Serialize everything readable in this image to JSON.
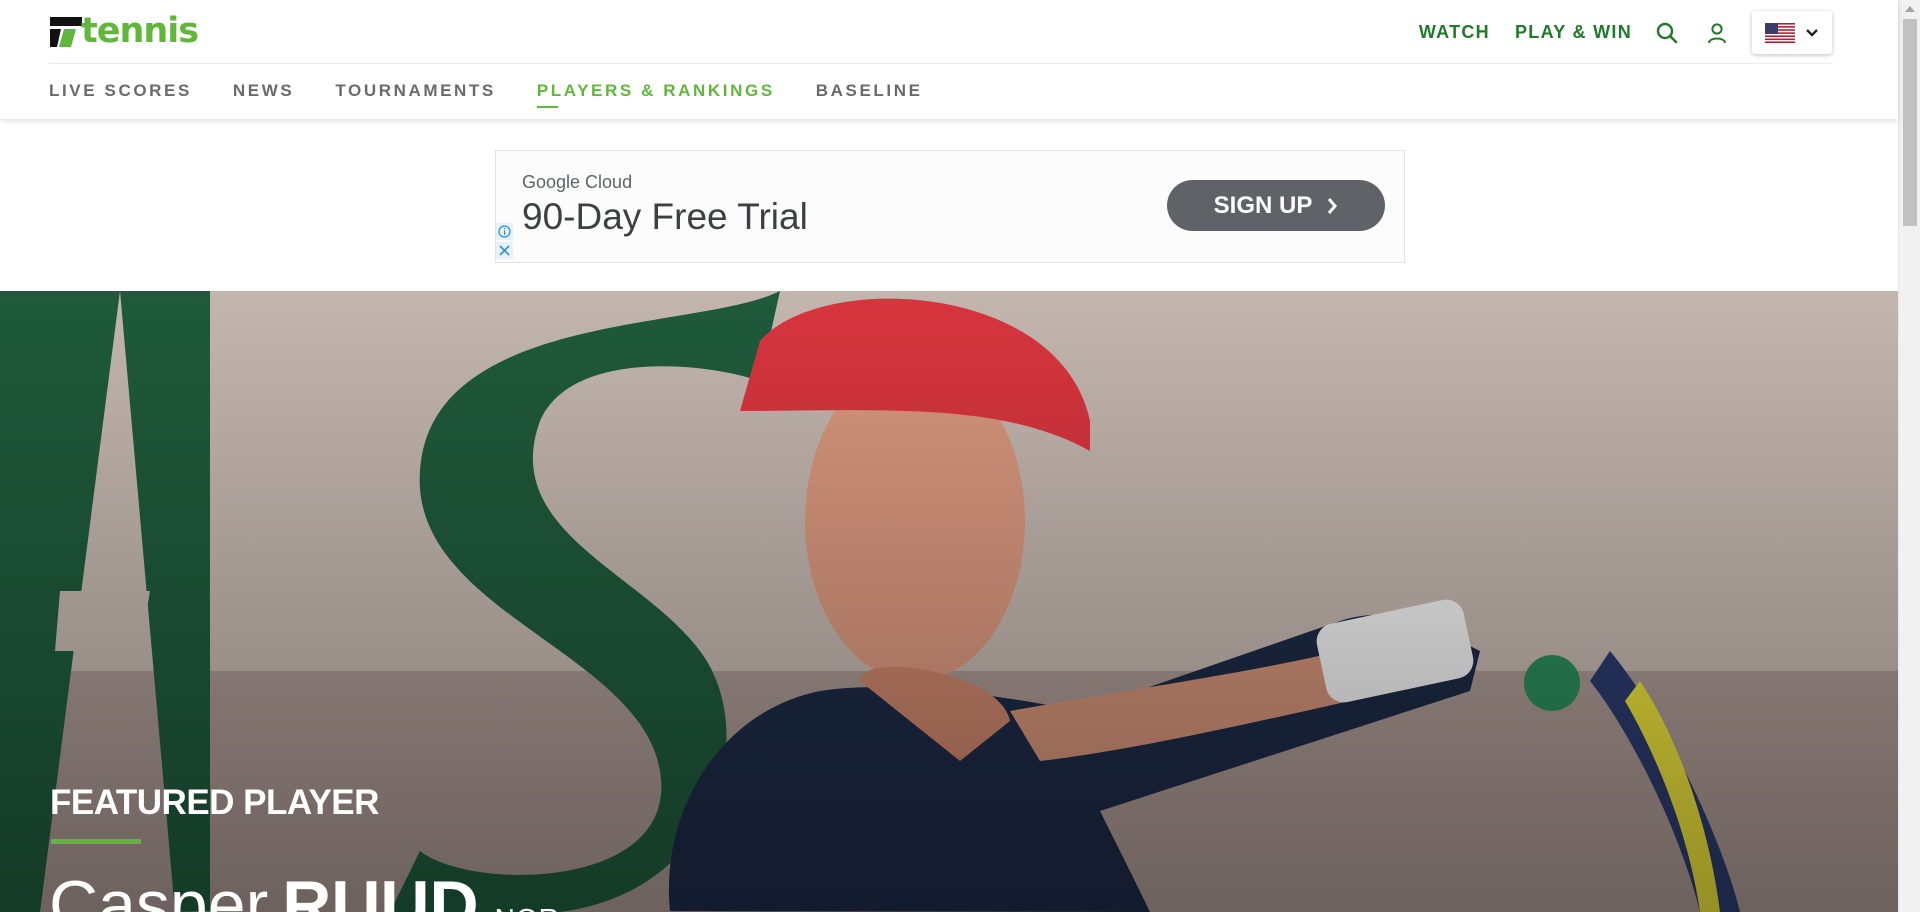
{
  "header": {
    "logo_text": "tennis",
    "top_links": [
      "WATCH",
      "PLAY & WIN"
    ],
    "icons": [
      "search-icon",
      "user-icon",
      "us-flag-icon",
      "chevron-down-icon"
    ],
    "nav": [
      {
        "label": "LIVE SCORES",
        "active": false
      },
      {
        "label": "NEWS",
        "active": false
      },
      {
        "label": "TOURNAMENTS",
        "active": false
      },
      {
        "label": "PLAYERS & RANKINGS",
        "active": true
      },
      {
        "label": "BASELINE",
        "active": false
      }
    ]
  },
  "ad": {
    "brand": "Google Cloud",
    "headline": "90-Day Free Trial",
    "cta": "SIGN UP",
    "icons": [
      "info-icon",
      "close-icon",
      "chevron-right-icon"
    ]
  },
  "hero": {
    "eyebrow": "FEATURED PLAYER",
    "first_name": "Casper",
    "last_name": "RUUD",
    "nationality": "NOR"
  },
  "colors": {
    "brand_green": "#5fb83a",
    "dark_green": "#1f7a2a",
    "nav_gray": "#6a6a6a",
    "ad_button": "#5f6368"
  }
}
